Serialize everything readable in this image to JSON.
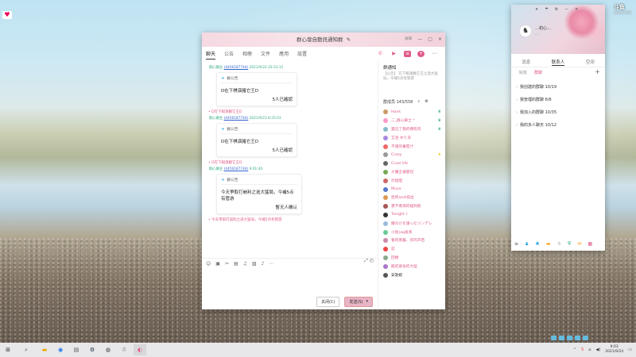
{
  "watermark": {
    "brand": "斗鱼",
    "url": "DOUYU.COM"
  },
  "chat": {
    "title": "群心發自動訊通知群",
    "title_icon": "edit-icon",
    "ctrl_labels": [
      "群聊",
      "—",
      "□",
      "✕"
    ],
    "tabs": [
      "聊天",
      "公告",
      "相冊",
      "文件",
      "應用",
      "設置"
    ],
    "messages": [
      {
        "meta_name": "群心鎖主",
        "meta_id": "(4456187744)",
        "meta_time": "2021/9/22 20:23:12",
        "card_head": "群公告",
        "card_body": "D在下棋演豬它王D",
        "card_conf": "5人已確認"
      },
      {
        "sys": "• D在下棋演豬它王D",
        "meta_name": "群心鎖主",
        "meta_id": "(4456187744)",
        "meta_time": "2021/9/23 8:25:03",
        "card_head": "群公告",
        "card_body": "D在下棋演豬它王D",
        "card_conf": "5人已確認"
      },
      {
        "sys": "• D在下棋演豬它王D",
        "meta_name": "群心鎖主",
        "meta_id": "(4456187744)",
        "meta_time": "9:01:40",
        "card_head": "群公告",
        "card_body": "今天爭取打崩利之逝大猛局，今補5点有管游",
        "card_conf": "暫无人确认"
      }
    ],
    "footer_sys": "• 今天爭取打崩利之逝大猛局，今補5点有管游",
    "buttons": {
      "close": "关闭(C)",
      "send": "发送(S)",
      "send_arrow": "▾"
    }
  },
  "sidebar": {
    "notice_title": "群通知",
    "notice_text": "【公告】 在下棋演豬它王之逝大猛局，今補5点有管游",
    "members_label": "群成员 143/558",
    "members": [
      {
        "name": "Hank",
        "color": "#e05a8a",
        "av": "#c96",
        "badge": "crown-icon"
      },
      {
        "name": "二_群心鎖士 *",
        "color": "#e05a8a",
        "av": "#f9c",
        "badge": "crown-icon"
      },
      {
        "name": "遇见了我的拥有肉",
        "color": "#e05a8a",
        "av": "#8bc",
        "badge": "crown-icon"
      },
      {
        "name": "艾洛 ゆりあ",
        "color": "#e05a8a",
        "av": "#a8d",
        "badge": ""
      },
      {
        "name": "不咀的番茄汁",
        "color": "#e05a8a",
        "av": "#e66",
        "badge": ""
      },
      {
        "name": "Crazy",
        "color": "#e05a8a",
        "av": "#999",
        "badge": "star-icon"
      },
      {
        "name": "Cruel life",
        "color": "#e05a8a",
        "av": "#666",
        "badge": ""
      },
      {
        "name": "大魔王被鹿包",
        "color": "#e05a8a",
        "av": "#7a5",
        "badge": ""
      },
      {
        "name": "烈燈燈",
        "color": "#e05a8a",
        "av": "#c66",
        "badge": ""
      },
      {
        "name": "Musa",
        "color": "#e05a8a",
        "av": "#57c",
        "badge": ""
      },
      {
        "name": "昆阿andi技拉",
        "color": "#e05a8a",
        "av": "#d95",
        "badge": ""
      },
      {
        "name": "裳不要演的碰到呢",
        "color": "#e05a8a",
        "av": "#a55",
        "badge": ""
      },
      {
        "name": "Tonight ♪",
        "color": "#e05a8a",
        "av": "#333",
        "badge": ""
      },
      {
        "name": "爾のけを譲ったツンデレ",
        "color": "#e05a8a",
        "av": "#9bd",
        "badge": ""
      },
      {
        "name": "小危(aq发英",
        "color": "#e05a8a",
        "av": "#6c9",
        "badge": ""
      },
      {
        "name": "誓的南露、买的声苗",
        "color": "#e05a8a",
        "av": "#c8a",
        "badge": ""
      },
      {
        "name": "蕊",
        "color": "#e05a8a",
        "av": "#e44",
        "badge": ""
      },
      {
        "name": "回楼",
        "color": "#e05a8a",
        "av": "#8a8",
        "badge": ""
      },
      {
        "name": "酷吃翠会的大猛",
        "color": "#e05a8a",
        "av": "#a7c",
        "badge": ""
      },
      {
        "name": "安歌娘",
        "color": "#333",
        "av": "#555",
        "badge": ""
      }
    ]
  },
  "friends": {
    "username": "…初心…",
    "signature": "…",
    "tabs": [
      "消息",
      "联系人",
      "空间"
    ],
    "subtabs": [
      "好友",
      "群聊"
    ],
    "groups": [
      "我创建的群聊 10/19",
      "我管理的群聊 6/6",
      "我加入的群聊 10/35",
      "我的多人聊天 10/12"
    ]
  },
  "taskbar": {
    "time": "9:03",
    "date": "2021/9/24"
  }
}
